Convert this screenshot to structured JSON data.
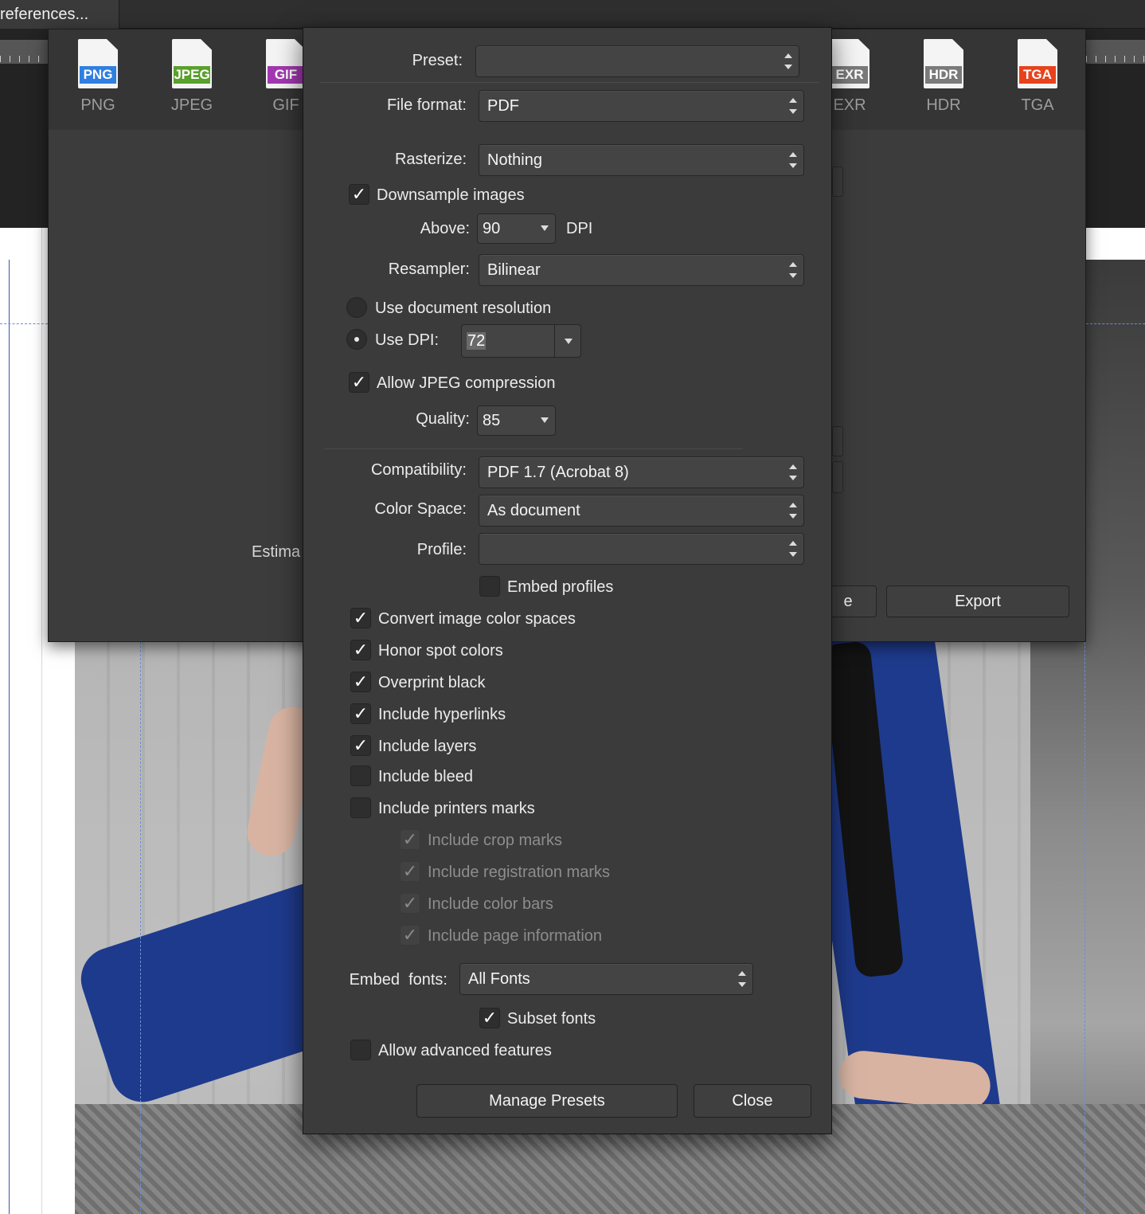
{
  "app": {
    "menu_title": "references..."
  },
  "formats": [
    {
      "tag": "PNG",
      "label": "PNG",
      "color": "#2f7fe0"
    },
    {
      "tag": "JPEG",
      "label": "JPEG",
      "color": "#5aa02c"
    },
    {
      "tag": "GIF",
      "label": "GIF",
      "color": "#a238b0"
    },
    {
      "tag": "EXR",
      "label": "EXR",
      "color": "#7a7a7a"
    },
    {
      "tag": "HDR",
      "label": "HDR",
      "color": "#7a7a7a"
    },
    {
      "tag": "TGA",
      "label": "TGA",
      "color": "#e8421c"
    }
  ],
  "export_panel": {
    "estimate_label": "Estima",
    "partial_button": "e",
    "export_button": "Export"
  },
  "dialog": {
    "preset": {
      "label": "Preset:",
      "value": ""
    },
    "file_format": {
      "label": "File format:",
      "value": "PDF"
    },
    "rasterize": {
      "label": "Rasterize:",
      "value": "Nothing"
    },
    "downsample": {
      "label": "Downsample images",
      "checked": true
    },
    "above": {
      "label": "Above:",
      "value": "90",
      "unit": "DPI"
    },
    "resampler": {
      "label": "Resampler:",
      "value": "Bilinear"
    },
    "use_document_resolution": {
      "label": "Use document resolution",
      "selected": false
    },
    "use_dpi": {
      "label": "Use DPI:",
      "value": "72",
      "selected": true
    },
    "allow_jpeg": {
      "label": "Allow JPEG compression",
      "checked": true
    },
    "quality": {
      "label": "Quality:",
      "value": "85"
    },
    "compatibility": {
      "label": "Compatibility:",
      "value": "PDF 1.7 (Acrobat 8)"
    },
    "color_space": {
      "label": "Color Space:",
      "value": "As document"
    },
    "profile": {
      "label": "Profile:",
      "value": ""
    },
    "embed_profiles": {
      "label": "Embed profiles",
      "checked": false
    },
    "options": [
      {
        "label": "Convert image color spaces",
        "checked": true
      },
      {
        "label": "Honor spot colors",
        "checked": true
      },
      {
        "label": "Overprint black",
        "checked": true
      },
      {
        "label": "Include hyperlinks",
        "checked": true
      },
      {
        "label": "Include layers",
        "checked": true
      },
      {
        "label": "Include bleed",
        "checked": false
      },
      {
        "label": "Include printers marks",
        "checked": false
      }
    ],
    "printer_marks": [
      {
        "label": "Include crop marks",
        "checked": true
      },
      {
        "label": "Include registration marks",
        "checked": true
      },
      {
        "label": "Include color bars",
        "checked": true
      },
      {
        "label": "Include page information",
        "checked": true
      }
    ],
    "embed_fonts": {
      "label": "Embed  fonts:",
      "value": "All Fonts"
    },
    "subset_fonts": {
      "label": "Subset fonts",
      "checked": true
    },
    "allow_advanced": {
      "label": "Allow advanced features",
      "checked": false
    },
    "buttons": {
      "manage_presets": "Manage Presets",
      "close": "Close"
    },
    "check_glyph": "✓"
  }
}
